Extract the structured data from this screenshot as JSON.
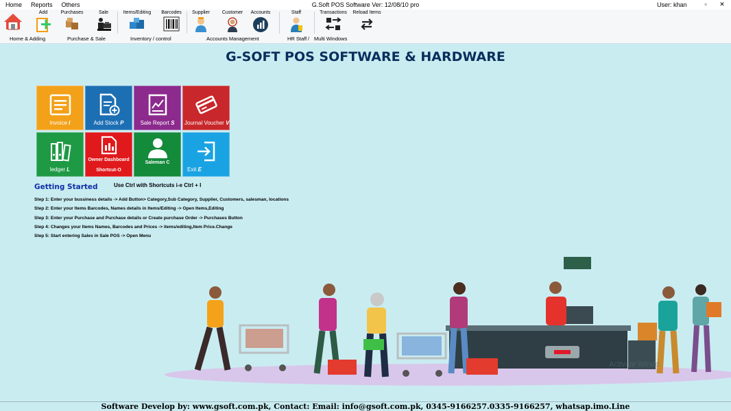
{
  "menu": [
    "Home",
    "Reports",
    "Others"
  ],
  "app_title": "G.Soft POS Software Ver: 12/08/10 pro",
  "user": "User: khan",
  "window_buttons": {
    "minimize": "▫",
    "close": "✕"
  },
  "ribbon": {
    "buttons": [
      {
        "label": "",
        "icon": "home-icon"
      },
      {
        "label": "Add",
        "icon": "add-icon"
      },
      {
        "label": "Purchases",
        "icon": "purchases-icon"
      },
      {
        "label": "Sale",
        "icon": "sale-icon"
      },
      {
        "label": "Items/Editing",
        "icon": "items-editing-icon"
      },
      {
        "label": "Barcodes",
        "icon": "barcode-icon"
      },
      {
        "label": "Supplier",
        "icon": "supplier-icon"
      },
      {
        "label": "Customer",
        "icon": "customer-icon"
      },
      {
        "label": "Accounts",
        "icon": "accounts-icon"
      },
      {
        "label": "Staff",
        "icon": "staff-icon"
      },
      {
        "label": "Transactions",
        "icon": "transactions-icon"
      },
      {
        "label": "Reload Items",
        "icon": "reload-icon"
      }
    ],
    "groups": [
      "Home & Adding",
      "Purchase & Sale",
      "Inventory / control",
      "Accounts Management",
      "HR Staff",
      "/",
      "Multi Windows"
    ]
  },
  "main_title": "G-SOFT POS SOFTWARE & HARDWARE",
  "tiles": [
    {
      "label": "Invoice",
      "key": "I",
      "color": "#f3a119"
    },
    {
      "label": "Add Stock",
      "key": "P",
      "color": "#1d6fb4"
    },
    {
      "label": "Sale Report",
      "key": "S",
      "color": "#8c2a8e"
    },
    {
      "label": "Journal Voucher",
      "key": "V",
      "color": "#c8282b"
    },
    {
      "label": "ledger",
      "key": "L",
      "color": "#1e9a45"
    },
    {
      "label": "Owner Dashboard",
      "label2": "Shortcut-O",
      "color": "#e0191c"
    },
    {
      "label": "Saleman C",
      "color": "#148a3b"
    },
    {
      "label": "Exit",
      "key": "E",
      "color": "#1aa3e3"
    }
  ],
  "getting_started": "Getting Started",
  "shortcut_hint": "Use Ctrl with Shortcuts i-e Ctrl + I",
  "steps": [
    "Step 1: Enter your bussiness details -> Add Button> Category,Sub Category, Supplier, Customers, salesman, locations",
    "Step 2: Enter your Items Barcodes, Names details in Items/Editing -> Open Items,Editing",
    "Step 3: Enter your Purchase and Purchase details or Create purchase Order -> Purchases Button",
    "Step 4: Changes your Items Names, Barcodes and Prices   -> items/editing,Item Price.Change",
    "Step 5: Start entering Sales in Sale POS -> Open Menu"
  ],
  "watermark": "Activate Windo",
  "footer": "Software Develop by: www.gsoft.com.pk, Contact: Email: info@gsoft.com.pk, 0345-9166257.0335-9166257, whatsap.imo.Line"
}
